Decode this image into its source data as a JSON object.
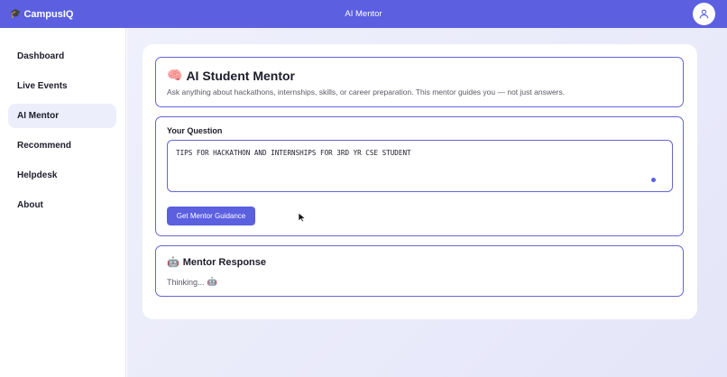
{
  "header": {
    "brand": "CampusIQ",
    "brand_icon": "graduation-cap-icon",
    "title": "AI Mentor",
    "accent": "#5b5fe0"
  },
  "sidebar": {
    "items": [
      {
        "label": "Dashboard"
      },
      {
        "label": "Live Events"
      },
      {
        "label": "AI Mentor",
        "active": true
      },
      {
        "label": "Recommend"
      },
      {
        "label": "Helpdesk"
      },
      {
        "label": "About"
      }
    ]
  },
  "intro": {
    "icon": "brain-icon",
    "title": "AI Student Mentor",
    "subtitle": "Ask anything about hackathons, internships, skills, or career preparation. This mentor guides you — not just answers."
  },
  "question": {
    "label": "Your Question",
    "value": "TIPS FOR HACKATHON AND INTERNSHIPS FOR 3RD YR CSE STUDENT",
    "button": "Get Mentor Guidance"
  },
  "response": {
    "icon": "robot-icon",
    "title": "Mentor Response",
    "text": "Thinking..."
  }
}
